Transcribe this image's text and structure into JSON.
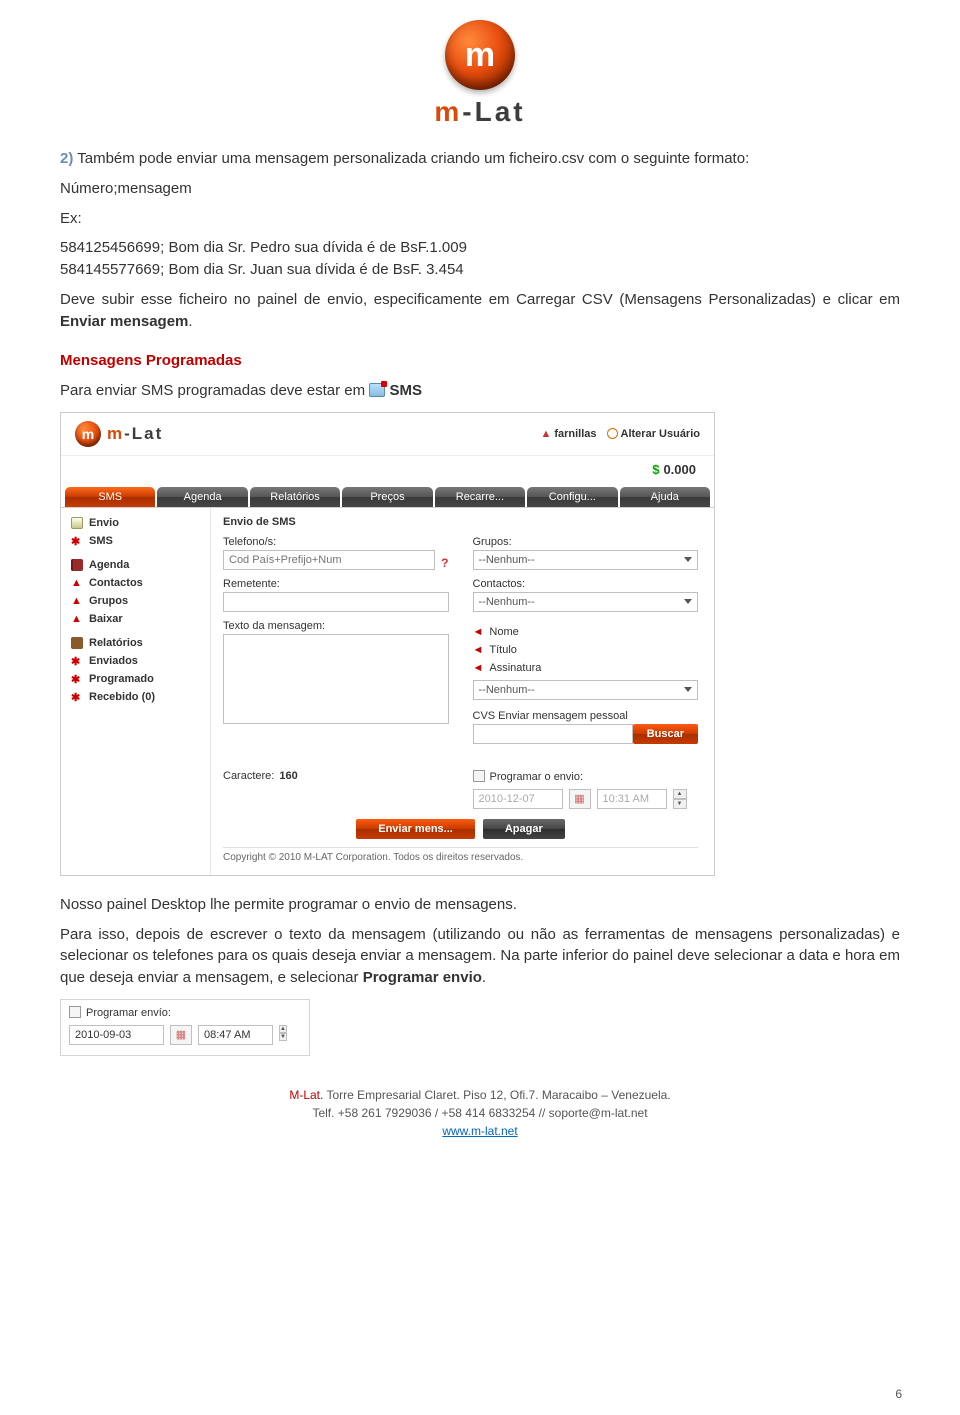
{
  "header": {
    "brand_prefix": "m",
    "brand_rest": "-Lat",
    "orb_letter": "m"
  },
  "doc": {
    "step2_num": "2)",
    "step2_text": " Também pode enviar uma mensagem personalizada criando um ficheiro.csv com o seguinte formato:",
    "numero": "Número;mensagem",
    "ex_label": "Ex:",
    "ex1": "584125456699; Bom dia Sr. Pedro sua dívida é de BsF.1.009",
    "ex2": "584145577669; Bom dia Sr. Juan sua dívida é de BsF. 3.454",
    "after_ex": "Deve subir esse ficheiro no painel de envio, especificamente em Carregar CSV (Mensagens Personalizadas) e clicar em ",
    "enviar_msg": "Enviar mensagem",
    "section_title": "Mensagens Programadas",
    "para_enviar": "Para enviar SMS programadas deve estar em ",
    "sms_word": "SMS",
    "after_panel": "Nosso painel Desktop lhe permite programar o envio de mensagens.",
    "long_para_a": "Para isso, depois de escrever o texto da mensagem (utilizando ou não as ferramentas de mensagens personalizadas) e selecionar os telefones para os quais deseja enviar a mensagem. Na parte inferior do painel deve selecionar a data e hora em que deseja enviar a mensagem, e selecionar ",
    "programar_envio": "Programar envio",
    "period": "."
  },
  "app": {
    "brand_prefix": "m",
    "brand_rest": "-Lat",
    "user_label": "farnillas",
    "alterar": "Alterar Usuário",
    "balance": "0.000",
    "tabs": [
      "SMS",
      "Agenda",
      "Relatórios",
      "Preços",
      "Recarre...",
      "Configu...",
      "Ajuda"
    ],
    "sidebar": {
      "envio": "Envio",
      "sms": "SMS",
      "agenda": "Agenda",
      "contactos": "Contactos",
      "grupos": "Grupos",
      "baixar": "Baixar",
      "relatorios": "Relatórios",
      "enviados": "Enviados",
      "programado": "Programado",
      "recebido": "Recebido (0)"
    },
    "main": {
      "title": "Envio de SMS",
      "telefono_label": "Telefono/s:",
      "telefono_placeholder": "Cod País+Prefijo+Num",
      "grupos_label": "Grupos:",
      "grupos_value": "--Nenhum--",
      "remetente_label": "Remetente:",
      "contactos_label": "Contactos:",
      "contactos_value": "--Nenhum--",
      "texto_label": "Texto da mensagem:",
      "nome": "Nome",
      "titulo": "Título",
      "assinatura": "Assinatura",
      "assinatura_value": "--Nenhum--",
      "csv_label": "CVS Enviar mensagem pessoal",
      "buscar": "Buscar",
      "caractere_label": "Caractere:",
      "caractere_val": "160",
      "programar_label": "Programar o envio:",
      "date": "2010-12-07",
      "time": "10:31 AM",
      "enviar_btn": "Enviar mens...",
      "apagar_btn": "Apagar",
      "copyright": "Copyright © 2010 M-LAT Corporation. Todos os direitos reservados."
    }
  },
  "widget": {
    "label": "Programar envío:",
    "date": "2010-09-03",
    "time": "08:47 AM"
  },
  "footer": {
    "l1a": "M-Lat.",
    "l1b": " Torre Empresarial Claret. Piso 12, Ofi.7. Maracaibo – Venezuela.",
    "l2": "Telf. +58 261 7929036 / +58 414 6833254 // soporte@m-lat.net",
    "l3": "www.m-lat.net",
    "page_num": "6"
  }
}
